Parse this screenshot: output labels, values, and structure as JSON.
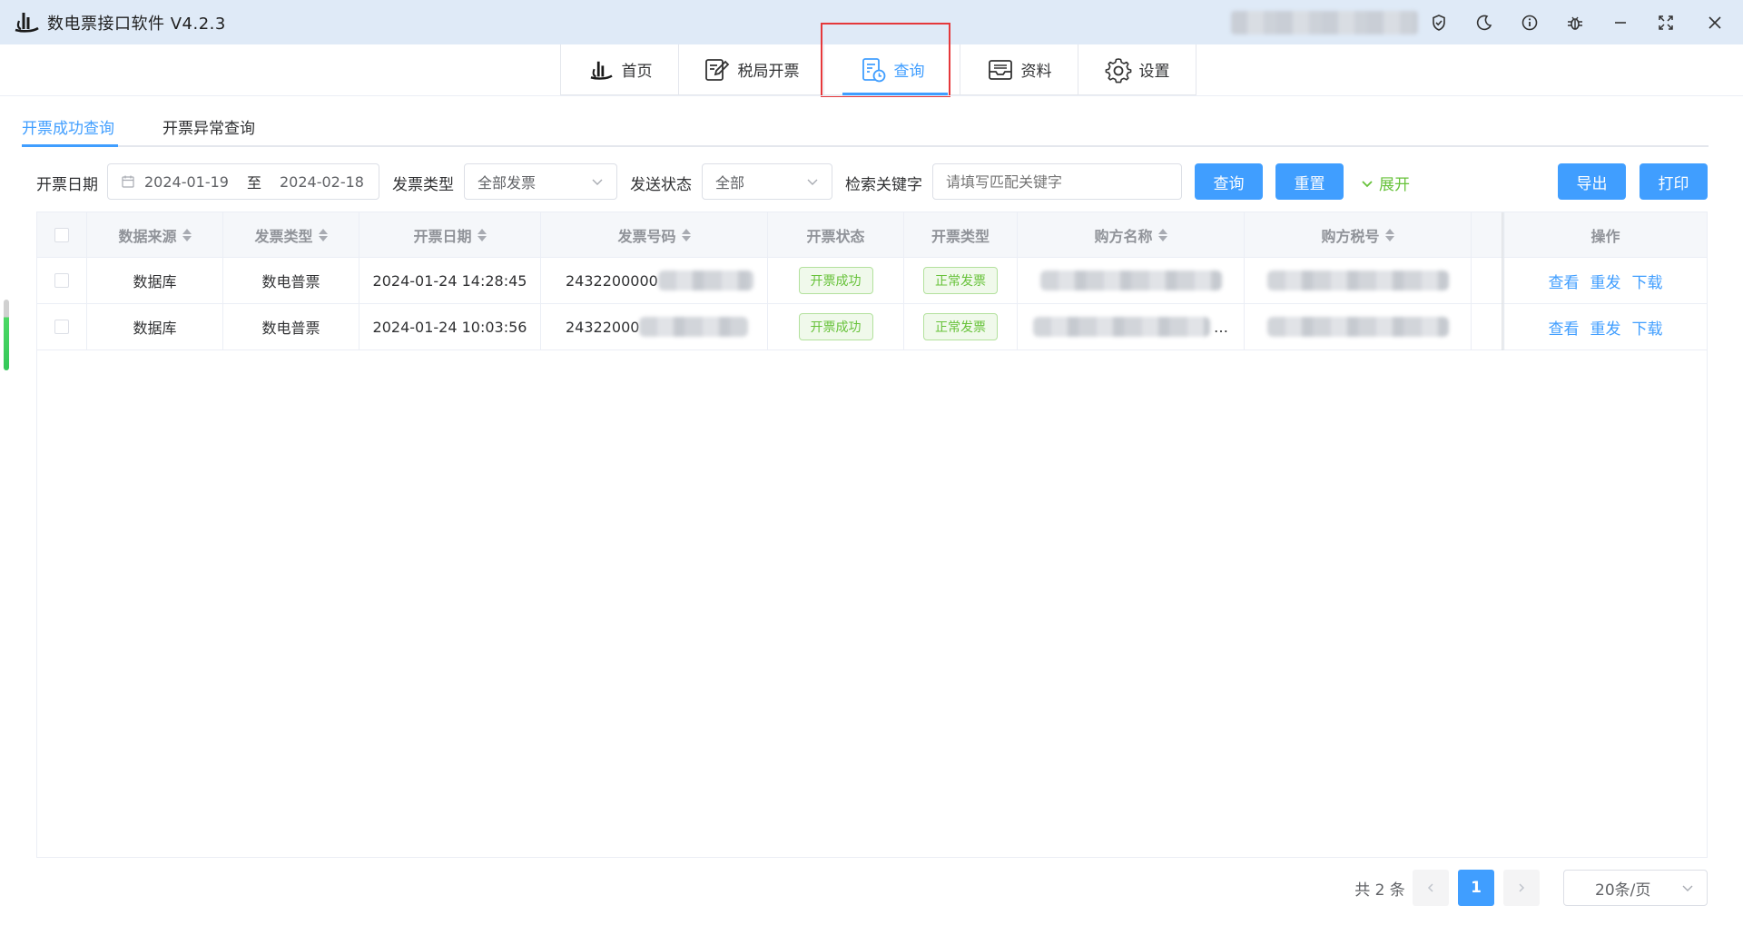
{
  "app": {
    "title": "数电票接口软件 V4.2.3"
  },
  "nav": {
    "items": [
      {
        "label": "首页",
        "icon": "logo-icon"
      },
      {
        "label": "税局开票",
        "icon": "edit-invoice-icon"
      },
      {
        "label": "查询",
        "icon": "query-doc-icon",
        "active": true
      },
      {
        "label": "资料",
        "icon": "inbox-icon"
      },
      {
        "label": "设置",
        "icon": "gear-icon"
      }
    ]
  },
  "subtabs": {
    "success": "开票成功查询",
    "abnormal": "开票异常查询"
  },
  "filters": {
    "date_label": "开票日期",
    "date_start": "2024-01-19",
    "date_sep": "至",
    "date_end": "2024-02-18",
    "type_label": "发票类型",
    "type_value": "全部发票",
    "send_label": "发送状态",
    "send_value": "全部",
    "keyword_label": "检索关键字",
    "keyword_placeholder": "请填写匹配关键字",
    "query_button": "查询",
    "reset_button": "重置",
    "expand_link": "展开",
    "export_button": "导出",
    "print_button": "打印"
  },
  "table": {
    "headers": [
      "数据来源",
      "发票类型",
      "开票日期",
      "发票号码",
      "开票状态",
      "开票类型",
      "购方名称",
      "购方税号",
      "操作"
    ],
    "rows": [
      {
        "source": "数据库",
        "type": "数电普票",
        "date": "2024-01-24 14:28:45",
        "number": "2432200000",
        "status": "开票成功",
        "kind": "正常发票",
        "buyer_ellipsis": ""
      },
      {
        "source": "数据库",
        "type": "数电普票",
        "date": "2024-01-24 10:03:56",
        "number": "24322000",
        "status": "开票成功",
        "kind": "正常发票",
        "buyer_ellipsis": "…"
      }
    ],
    "actions": {
      "view": "查看",
      "resend": "重发",
      "download": "下载"
    }
  },
  "pagination": {
    "total": "共 2 条",
    "current": "1",
    "page_size": "20条/页"
  },
  "colors": {
    "accent": "#409eff",
    "success": "#67c23a",
    "highlight_box": "#e5383b"
  }
}
